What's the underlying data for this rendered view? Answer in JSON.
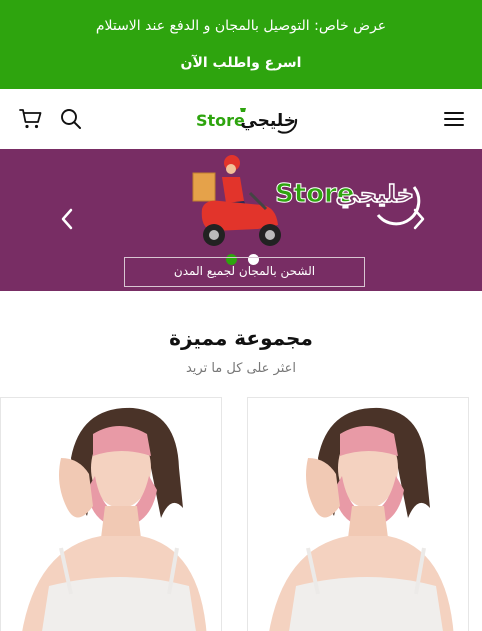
{
  "announcement": {
    "line1": "عرض خاص: التوصيل بالمجان و الدفع عند الاستلام",
    "line2": "اسرع واطلب الآن"
  },
  "header": {
    "logo_arabic": "خليجي",
    "logo_latin": "Store",
    "icons": [
      "cart-icon",
      "search-icon",
      "menu-icon"
    ]
  },
  "hero": {
    "logo_arabic": "خليجي",
    "logo_latin": "Store",
    "caption": "الشحن بالمجان لجميع المدن",
    "slides": 2,
    "active_slide": 1
  },
  "collection": {
    "title": "مجموعة مميزة",
    "subtitle": "اعثر على كل ما تريد"
  },
  "colors": {
    "brand_green": "#2ea40e",
    "hero_purple": "#782d64",
    "mask_pink": "#e89aa6"
  },
  "products": [
    {
      "name": "product-card-1"
    },
    {
      "name": "product-card-2"
    }
  ]
}
